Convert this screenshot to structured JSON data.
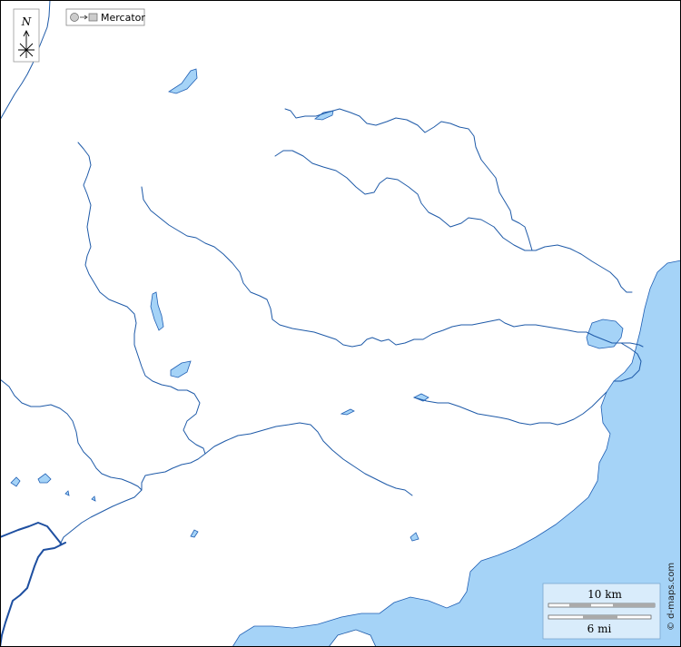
{
  "compass": {
    "north_label": "N"
  },
  "projection": {
    "label": "Mercator",
    "icon": "globe-to-plane-icon"
  },
  "scale_bar": {
    "distance_km_label": "10 km",
    "distance_mi_label": "6 mi"
  },
  "credit": {
    "label": "© d-maps.com"
  },
  "colors": {
    "water": "#a5d3f7",
    "river": "#1e5aa8",
    "land": "#ffffff",
    "border": "#1e4fa0"
  }
}
